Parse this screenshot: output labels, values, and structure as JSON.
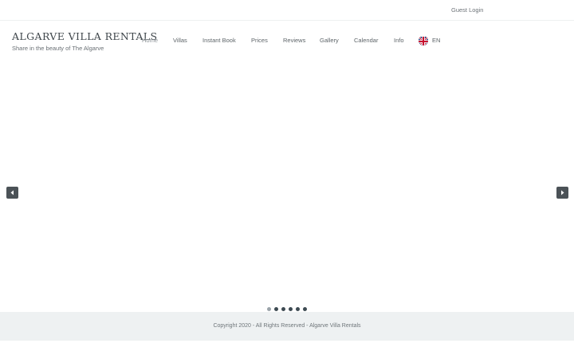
{
  "topbar": {
    "guest_login": "Guest Login"
  },
  "brand": {
    "title": "ALGARVE VILLA RENTALS",
    "tagline": "Share in the beauty of The Algarve"
  },
  "nav": {
    "items": [
      "Home",
      "Villas",
      "Instant Book",
      "Prices",
      "Reviews",
      "Gallery",
      "Calendar",
      "Info"
    ],
    "active": "Home"
  },
  "language": {
    "code": "EN",
    "icon": "uk-flag-icon"
  },
  "slider": {
    "prev_icon": "caret-left-icon",
    "next_icon": "caret-right-icon",
    "slide_count": 6,
    "active_slide": 1
  },
  "footer": {
    "copyright": "Copyright 2020 - All Rights Reserved - Algarve Villa Rentals"
  },
  "colors": {
    "footer_bg": "#eef1f2",
    "arrow_bg": "#4b5257",
    "dot": "#3d4a52",
    "dot_active": "#9aa3a9"
  }
}
